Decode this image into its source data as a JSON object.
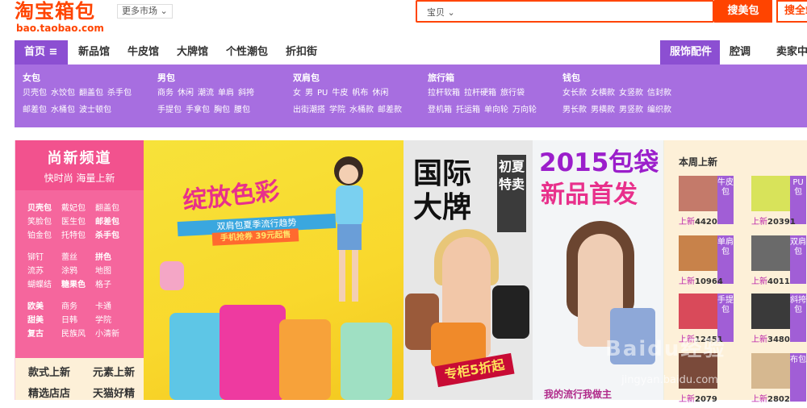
{
  "logo": {
    "main": "淘宝箱包",
    "sub": "bao.taobao.com"
  },
  "market": {
    "label": "更多市场 ⌄"
  },
  "search": {
    "category": "宝贝 ⌄",
    "placeholder": "",
    "btn_primary": "搜美包",
    "btn_secondary": "搜全站"
  },
  "nav": {
    "home": "首页 ≡",
    "items": [
      "新品馆",
      "牛皮馆",
      "大牌馆",
      "个性潮包",
      "折扣街"
    ],
    "right": [
      "服饰配件",
      "腔调",
      "卖家中心"
    ]
  },
  "categories": [
    {
      "title": "女包",
      "rows": [
        [
          "贝壳包",
          "水饺包",
          "翻盖包",
          "杀手包"
        ],
        [
          "邮差包",
          "水桶包",
          "波士顿包"
        ]
      ]
    },
    {
      "title": "男包",
      "rows": [
        [
          "商务",
          "休闲",
          "潮流",
          "单肩",
          "斜挎"
        ],
        [
          "手提包",
          "手拿包",
          "胸包",
          "腰包"
        ]
      ]
    },
    {
      "title": "双肩包",
      "rows": [
        [
          "女",
          "男",
          "PU",
          "牛皮",
          "帆布",
          "休闲"
        ],
        [
          "出街潮搭",
          "学院",
          "水桶款",
          "邮差款"
        ]
      ]
    },
    {
      "title": "旅行箱",
      "rows": [
        [
          "拉杆软箱",
          "拉杆硬箱",
          "旅行袋"
        ],
        [
          "登机箱",
          "托运箱",
          "单向轮",
          "万向轮"
        ]
      ]
    },
    {
      "title": "钱包",
      "rows": [
        [
          "女长款",
          "女横款",
          "女竖款",
          "信封款"
        ],
        [
          "男长款",
          "男横款",
          "男竖款",
          "编织款"
        ]
      ]
    }
  ],
  "sidebar": {
    "title": "尚新频道",
    "sub": "快时尚  海量上新",
    "block1": [
      "贝壳包",
      "戴妃包",
      "翻盖包",
      "笑脸包",
      "医生包",
      "邮差包",
      "铂金包",
      "托特包",
      "杀手包"
    ],
    "block2": [
      "铆钉",
      "蕾丝",
      "拼色",
      "流苏",
      "涂鸦",
      "地图",
      "蝴蝶结",
      "糖果色",
      "格子"
    ],
    "block3": [
      "欧美",
      "商务",
      "卡通",
      "甜美",
      "日韩",
      "学院",
      "复古",
      "民族风",
      "小清新"
    ],
    "foot": [
      "款式上新",
      "元素上新",
      "精选店店",
      "天猫好精"
    ]
  },
  "banner1": {
    "title": "绽放色彩",
    "strip": "双肩包夏季流行趋势",
    "strip2": "手机抢券  39元起售"
  },
  "banner2": {
    "title_line1": "国际",
    "title_line2": "大牌",
    "box": "初夏特卖",
    "promo": "专柜5折起"
  },
  "banner3": {
    "title": "2015包袋",
    "sub": "新品首发",
    "foot": "我的流行我做主"
  },
  "right": {
    "title": "本周上新",
    "products": [
      {
        "tag": "牛皮包",
        "new_label": "上新",
        "count": "4420",
        "color": "#c47a6a"
      },
      {
        "tag": "PU包",
        "new_label": "上新",
        "count": "20391",
        "color": "#d8e35a"
      },
      {
        "tag": "单肩包",
        "new_label": "上新",
        "count": "10964",
        "color": "#c8824a"
      },
      {
        "tag": "双肩包",
        "new_label": "上新",
        "count": "4011",
        "color": "#6a6a6a"
      },
      {
        "tag": "手提包",
        "new_label": "上新",
        "count": "12451",
        "color": "#d94a5a"
      },
      {
        "tag": "斜挎包",
        "new_label": "上新",
        "count": "3480",
        "color": "#3a3a3a"
      },
      {
        "tag": "",
        "new_label": "上新",
        "count": "2079",
        "color": "#7a4a3a"
      },
      {
        "tag": "布包",
        "new_label": "上新",
        "count": "2802",
        "color": "#d6b890"
      }
    ]
  },
  "watermark": {
    "main": "Baidu经验",
    "sub": "jingyan.baidu.com"
  }
}
